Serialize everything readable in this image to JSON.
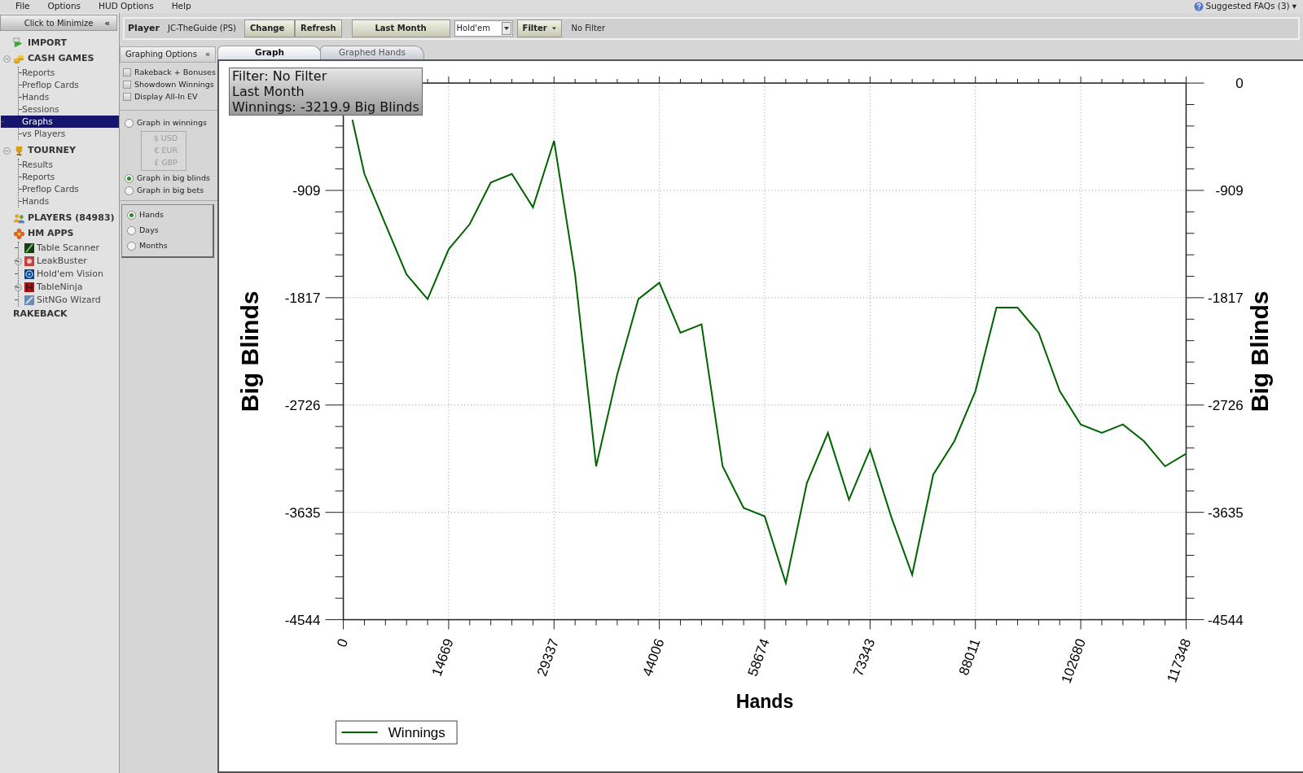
{
  "menu": [
    "File",
    "Options",
    "HUD Options",
    "Help"
  ],
  "faq": {
    "label": "Suggested FAQs (3)",
    "caret": "▾"
  },
  "sidebar": {
    "minimize_label": "Click to Minimize",
    "minimize_glyph": "«",
    "sections": [
      {
        "label": "IMPORT"
      },
      {
        "label": "CASH GAMES",
        "expanded": true,
        "children": [
          {
            "label": "Reports",
            "selected": false
          },
          {
            "label": "Preflop Cards",
            "selected": false
          },
          {
            "label": "Hands",
            "selected": false
          },
          {
            "label": "Sessions",
            "selected": false
          },
          {
            "label": "Graphs",
            "selected": true
          },
          {
            "label": "vs Players",
            "selected": false
          }
        ]
      },
      {
        "label": "TOURNEY",
        "expanded": true,
        "children": [
          {
            "label": "Results",
            "selected": false
          },
          {
            "label": "Reports",
            "selected": false
          },
          {
            "label": "Preflop Cards",
            "selected": false
          },
          {
            "label": "Hands",
            "selected": false
          }
        ]
      },
      {
        "label": "PLAYERS (84983)"
      },
      {
        "label": "HM APPS",
        "children": [
          {
            "label": "Table Scanner",
            "selected": false
          },
          {
            "label": "LeakBuster",
            "selected": false,
            "expanded": false
          },
          {
            "label": "Hold'em Vision",
            "selected": false
          },
          {
            "label": "TableNinja",
            "selected": false,
            "expanded": false
          },
          {
            "label": "SitNGo Wizard",
            "selected": false
          }
        ]
      },
      {
        "label": "RAKEBACK"
      }
    ]
  },
  "toolbar": {
    "player_label": "Player",
    "player": "JC-TheGuide (PS)",
    "change": "Change",
    "refresh": "Refresh",
    "period": "Last Month",
    "game": "Hold'em",
    "filter": "Filter",
    "filter_status": "No Filter"
  },
  "options": {
    "title": "Graphing Options",
    "collapse_glyph": "«",
    "checkboxes": [
      {
        "label": "Rakeback + Bonuses",
        "checked": false
      },
      {
        "label": "Showdown Winnings",
        "checked": false
      },
      {
        "label": "Display All-In EV",
        "checked": false
      }
    ],
    "units": [
      {
        "label": "Graph in winnings",
        "selected": false
      },
      {
        "label": "Graph in big blinds",
        "selected": true
      },
      {
        "label": "Graph in big bets",
        "selected": false
      }
    ],
    "currencies": [
      {
        "label": "$ USD",
        "disabled": true
      },
      {
        "label": "€ EUR",
        "disabled": true
      },
      {
        "label": "£ GBP",
        "disabled": true
      }
    ],
    "periods": [
      {
        "label": "Hands",
        "selected": true
      },
      {
        "label": "Days",
        "selected": false
      },
      {
        "label": "Months",
        "selected": false
      }
    ]
  },
  "tabs": [
    {
      "label": "Graph",
      "selected": true
    },
    {
      "label": "Graphed Hands",
      "selected": false
    }
  ],
  "graph": {
    "info": [
      "Filter: No Filter",
      "Last Month",
      "Winnings: -3219.9 Big Blinds"
    ],
    "left_axis_labels": [
      "-909",
      "-1817",
      "-2726",
      "-3635",
      "-4544"
    ],
    "left_axis_title": "Big Blinds",
    "chart_data": {
      "type": "line",
      "grid": true,
      "xlabel": "Hands",
      "ylabel": "Big Blinds",
      "xlim": [
        0,
        117348
      ],
      "ylim": [
        -4544,
        0
      ],
      "xticks": [
        0,
        14669,
        29337,
        44006,
        58674,
        73343,
        88011,
        102680,
        117348
      ],
      "yticks": [
        0,
        -909,
        -1817,
        -2726,
        -3635,
        -4544
      ],
      "x": [
        1265,
        2934,
        5867,
        8801,
        11735,
        14669,
        17602,
        20536,
        23470,
        26403,
        29337,
        32271,
        35204,
        38138,
        41072,
        44006,
        46939,
        49873,
        52807,
        55740,
        58674,
        61608,
        64542,
        67475,
        70409,
        73343,
        76276,
        79210,
        82144,
        85077,
        88011,
        90945,
        93879,
        96812,
        99746,
        102680,
        105613,
        108547,
        111481,
        114414,
        117348
      ],
      "series": [
        {
          "name": "Winnings",
          "color": "#006400",
          "values": [
            -311,
            -770,
            -1195,
            -1620,
            -1830,
            -1407,
            -1195,
            -842,
            -770,
            -1053,
            -488,
            -1620,
            -3245,
            -2467,
            -1830,
            -1690,
            -2114,
            -2043,
            -3245,
            -3598,
            -3669,
            -4234,
            -3386,
            -2962,
            -3527,
            -3103,
            -3669,
            -4163,
            -3315,
            -3033,
            -2608,
            -1901,
            -1901,
            -2114,
            -2608,
            -2891,
            -2962,
            -2891,
            -3033,
            -3245,
            -3139
          ]
        }
      ]
    }
  }
}
